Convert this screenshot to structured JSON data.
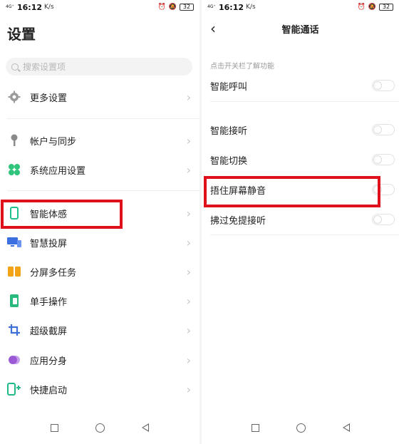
{
  "status_bar": {
    "network": "4G⁺",
    "time": "16:12",
    "data_rate": "K/s",
    "battery": "32"
  },
  "left": {
    "title": "设置",
    "search": {
      "placeholder": "搜索设置项"
    },
    "items": [
      {
        "label": "更多设置",
        "icon": "gear-icon",
        "color": "#9b9b9b"
      },
      {
        "label": "帐户与同步",
        "icon": "key-icon",
        "color": "#8a8a8a"
      },
      {
        "label": "系统应用设置",
        "icon": "clover-icon",
        "color": "#2fc47b"
      },
      {
        "label": "智能体感",
        "icon": "phone-outline-icon",
        "color": "#1fbf8f"
      },
      {
        "label": "智慧投屏",
        "icon": "screen-cast-icon",
        "color": "#3c6fe0"
      },
      {
        "label": "分屏多任务",
        "icon": "split-screen-icon",
        "color": "#f3a316"
      },
      {
        "label": "单手操作",
        "icon": "one-hand-icon",
        "color": "#29b97c"
      },
      {
        "label": "超级截屏",
        "icon": "crop-icon",
        "color": "#3f6fd9"
      },
      {
        "label": "应用分身",
        "icon": "clone-icon",
        "color": "#9b59d6"
      },
      {
        "label": "快捷启动",
        "icon": "quick-launch-icon",
        "color": "#20b98a"
      }
    ]
  },
  "right": {
    "title": "智能通话",
    "hint": "点击开关栏了解功能",
    "toggles": [
      {
        "label": "智能呼叫",
        "on": false
      },
      {
        "label": "智能接听",
        "on": false
      },
      {
        "label": "智能切换",
        "on": false
      },
      {
        "label": "捂住屏幕静音",
        "on": false
      },
      {
        "label": "拂过免提接听",
        "on": false
      }
    ]
  },
  "annotation_color": "#e0101a"
}
